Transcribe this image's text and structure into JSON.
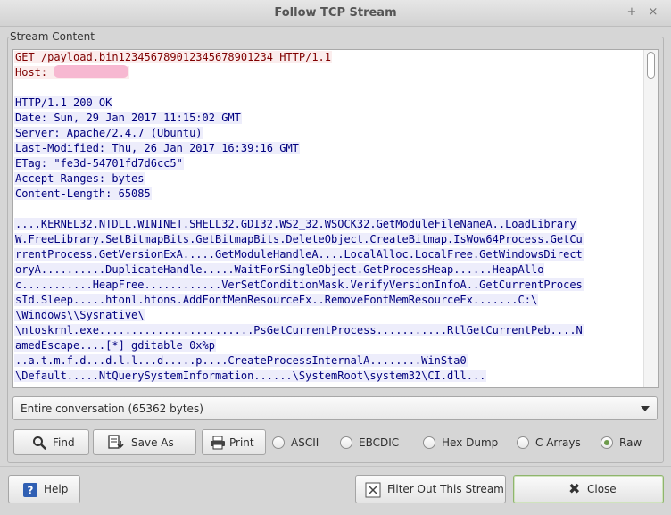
{
  "window": {
    "title": "Follow TCP Stream",
    "controls": [
      "minimize-icon",
      "maximize-icon",
      "close-icon"
    ]
  },
  "stream_group": {
    "label": "Stream Content"
  },
  "stream_lines": [
    {
      "side": "client",
      "text": "GET /payload.bin12345678901234567890123​4 HTTP/1.1"
    },
    {
      "side": "client",
      "text": "Host: ",
      "redacted": true
    },
    {
      "side": "blank",
      "text": ""
    },
    {
      "side": "server",
      "text": "HTTP/1.1 200 OK"
    },
    {
      "side": "server",
      "text": "Date: Sun, 29 Jan 2017 11:15:02 GMT"
    },
    {
      "side": "server",
      "text": "Server: Apache/2.4.7 (Ubuntu)"
    },
    {
      "side": "server",
      "text": "Last-Modified: Thu, 26 Jan 2017 16:39:16 GMT",
      "caret_at": 15
    },
    {
      "side": "server",
      "text": "ETag: \"fe3d-54701fd7d6cc5\""
    },
    {
      "side": "server",
      "text": "Accept-Ranges: bytes"
    },
    {
      "side": "server",
      "text": "Content-Length: 65085"
    },
    {
      "side": "blank",
      "text": ""
    },
    {
      "side": "server",
      "text": "....KERNEL32.NTDLL.WININET.SHELL32.GDI32.WS2_32.WSOCK32.GetModuleFileNameA..LoadLibrary"
    },
    {
      "side": "server",
      "text": "W.FreeLibrary.SetBitmapBits.GetBitmapBits.DeleteObject.CreateBitmap.IsWow64Process.GetCu"
    },
    {
      "side": "server",
      "text": "rrentProcess.GetVersionExA.....GetModuleHandleA....LocalAlloc.LocalFree.GetWindowsDirect"
    },
    {
      "side": "server",
      "text": "oryA..........DuplicateHandle.....WaitForSingleObject.GetProcessHeap......HeapAllo"
    },
    {
      "side": "server",
      "text": "c...........HeapFree............VerSetConditionMask.VerifyVersionInfoA..GetCurrentProces"
    },
    {
      "side": "server",
      "text": "sId.Sleep.....htonl.htons.AddFontMemResourceEx..RemoveFontMemResourceEx.......C:\\"
    },
    {
      "side": "server",
      "text": "\\Windows\\\\Sysnative\\"
    },
    {
      "side": "server",
      "text": "\\ntoskrnl.exe........................PsGetCurrentProcess...........RtlGetCurrentPeb....N"
    },
    {
      "side": "server",
      "text": "amedEscape....[*] gditable 0x%p"
    },
    {
      "side": "server",
      "text": "..a.t.m.f.d...d.l.l...d.....p....CreateProcessInternalA........WinSta0"
    },
    {
      "side": "server",
      "text": "\\Default.....NtQuerySystemInformation......\\SystemRoot\\system32\\CI.dll..."
    }
  ],
  "conversation_select": {
    "value": "Entire conversation (65362 bytes)"
  },
  "buttons": {
    "find": "Find",
    "save_as": "Save As",
    "print": "Print",
    "help": "Help",
    "filter_out": "Filter Out This Stream",
    "close": "Close"
  },
  "radios": [
    {
      "label": "ASCII",
      "checked": false
    },
    {
      "label": "EBCDIC",
      "checked": false
    },
    {
      "label": "Hex Dump",
      "checked": false
    },
    {
      "label": "C Arrays",
      "checked": false
    },
    {
      "label": "Raw",
      "checked": true
    }
  ],
  "colors": {
    "client_fg": "#7f0000",
    "client_bg": "#fbeded",
    "server_fg": "#00007f",
    "server_bg": "#ededfb",
    "accent": "#6d9a4b"
  }
}
